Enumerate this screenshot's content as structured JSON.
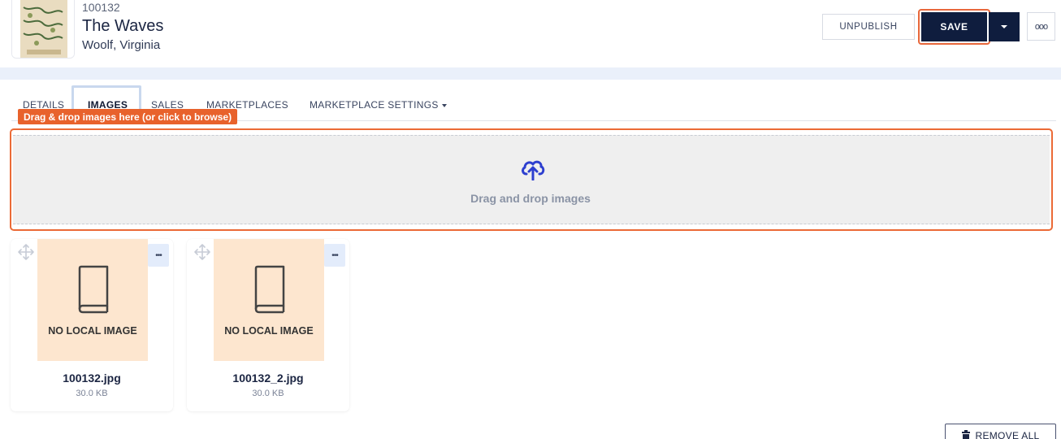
{
  "product": {
    "sku": "100132",
    "title": "The Waves",
    "author": "Woolf, Virginia"
  },
  "toolbar": {
    "unpublish_label": "UNPUBLISH",
    "save_label": "SAVE",
    "more_label": "ooo"
  },
  "tabs": [
    {
      "label": "DETAILS",
      "active": false
    },
    {
      "label": "IMAGES",
      "active": true
    },
    {
      "label": "SALES",
      "active": false
    },
    {
      "label": "MARKETPLACES",
      "active": false
    },
    {
      "label": "MARKETPLACE SETTINGS",
      "active": false
    }
  ],
  "tooltip": "Drag & drop images here (or click to browse)",
  "dropzone": {
    "label": "Drag and drop images"
  },
  "images": [
    {
      "placeholder": "NO LOCAL IMAGE",
      "filename": "100132.jpg",
      "size": "30.0 KB",
      "menu": "•••"
    },
    {
      "placeholder": "NO LOCAL IMAGE",
      "filename": "100132_2.jpg",
      "size": "30.0 KB",
      "menu": "•••"
    }
  ],
  "remove_all_label": "REMOVE ALL",
  "colors": {
    "primary": "#0f1d3e",
    "highlight": "#eb6a36",
    "upload_icon": "#2d3fcf",
    "placeholder_bg": "#fde6cf"
  }
}
